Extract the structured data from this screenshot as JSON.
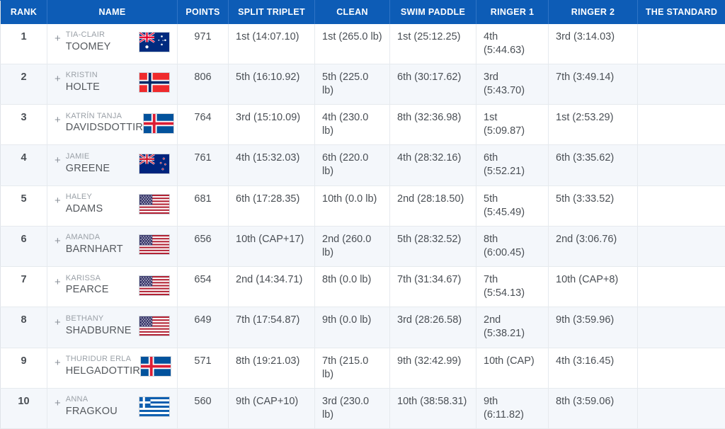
{
  "theme": {
    "header_bg": "#0d5cb6",
    "header_text": "#ffffff",
    "row_alt_bg": "#f4f7fb",
    "row_bg": "#ffffff",
    "border": "#e6eaee",
    "text": "#4a4f55",
    "muted_text": "#9aa0a7"
  },
  "table": {
    "columns": [
      {
        "key": "rank",
        "label": "RANK"
      },
      {
        "key": "name",
        "label": "NAME"
      },
      {
        "key": "points",
        "label": "POINTS"
      },
      {
        "key": "split",
        "label": "SPLIT TRIPLET"
      },
      {
        "key": "clean",
        "label": "CLEAN"
      },
      {
        "key": "swim",
        "label": "SWIM PADDLE"
      },
      {
        "key": "ringer1",
        "label": "RINGER 1"
      },
      {
        "key": "ringer2",
        "label": "RINGER 2"
      },
      {
        "key": "standard",
        "label": "THE STANDARD"
      }
    ],
    "expand_label": "+",
    "rows": [
      {
        "rank": "1",
        "first_name": "TIA-CLAIR",
        "last_name": "TOOMEY",
        "flag": "australia",
        "points": "971",
        "split": "1st (14:07.10)",
        "clean": "1st (265.0 lb)",
        "swim": "1st (25:12.25)",
        "ringer1": "4th (5:44.63)",
        "ringer2": "3rd (3:14.03)",
        "standard": ""
      },
      {
        "rank": "2",
        "first_name": "KRISTIN",
        "last_name": "HOLTE",
        "flag": "norway",
        "points": "806",
        "split": "5th (16:10.92)",
        "clean": "5th (225.0 lb)",
        "swim": "6th (30:17.62)",
        "ringer1": "3rd (5:43.70)",
        "ringer2": "7th (3:49.14)",
        "standard": ""
      },
      {
        "rank": "3",
        "first_name": "KATRÍN TANJA",
        "last_name": "DAVIDSDOTTIR",
        "flag": "iceland",
        "points": "764",
        "split": "3rd (15:10.09)",
        "clean": "4th (230.0 lb)",
        "swim": "8th (32:36.98)",
        "ringer1": "1st (5:09.87)",
        "ringer2": "1st (2:53.29)",
        "standard": ""
      },
      {
        "rank": "4",
        "first_name": "JAMIE",
        "last_name": "GREENE",
        "flag": "newzealand",
        "points": "761",
        "split": "4th (15:32.03)",
        "clean": "6th (220.0 lb)",
        "swim": "4th (28:32.16)",
        "ringer1": "6th (5:52.21)",
        "ringer2": "6th (3:35.62)",
        "standard": ""
      },
      {
        "rank": "5",
        "first_name": "HALEY",
        "last_name": "ADAMS",
        "flag": "usa",
        "points": "681",
        "split": "6th (17:28.35)",
        "clean": "10th (0.0 lb)",
        "swim": "2nd (28:18.50)",
        "ringer1": "5th (5:45.49)",
        "ringer2": "5th (3:33.52)",
        "standard": ""
      },
      {
        "rank": "6",
        "first_name": "AMANDA",
        "last_name": "BARNHART",
        "flag": "usa",
        "points": "656",
        "split": "10th (CAP+17)",
        "clean": "2nd (260.0 lb)",
        "swim": "5th (28:32.52)",
        "ringer1": "8th (6:00.45)",
        "ringer2": "2nd (3:06.76)",
        "standard": ""
      },
      {
        "rank": "7",
        "first_name": "KARISSA",
        "last_name": "PEARCE",
        "flag": "usa",
        "points": "654",
        "split": "2nd (14:34.71)",
        "clean": "8th (0.0 lb)",
        "swim": "7th (31:34.67)",
        "ringer1": "7th (5:54.13)",
        "ringer2": "10th (CAP+8)",
        "standard": ""
      },
      {
        "rank": "8",
        "first_name": "BETHANY",
        "last_name": "SHADBURNE",
        "flag": "usa",
        "points": "649",
        "split": "7th (17:54.87)",
        "clean": "9th (0.0 lb)",
        "swim": "3rd (28:26.58)",
        "ringer1": "2nd (5:38.21)",
        "ringer2": "9th (3:59.96)",
        "standard": ""
      },
      {
        "rank": "9",
        "first_name": "THURIDUR ERLA",
        "last_name": "HELGADOTTIR",
        "flag": "iceland",
        "points": "571",
        "split": "8th (19:21.03)",
        "clean": "7th (215.0 lb)",
        "swim": "9th (32:42.99)",
        "ringer1": "10th (CAP)",
        "ringer2": "4th (3:16.45)",
        "standard": ""
      },
      {
        "rank": "10",
        "first_name": "ANNA",
        "last_name": "FRAGKOU",
        "flag": "greece",
        "points": "560",
        "split": "9th (CAP+10)",
        "clean": "3rd (230.0 lb)",
        "swim": "10th (38:58.31)",
        "ringer1": "9th (6:11.82)",
        "ringer2": "8th (3:59.06)",
        "standard": ""
      }
    ]
  }
}
